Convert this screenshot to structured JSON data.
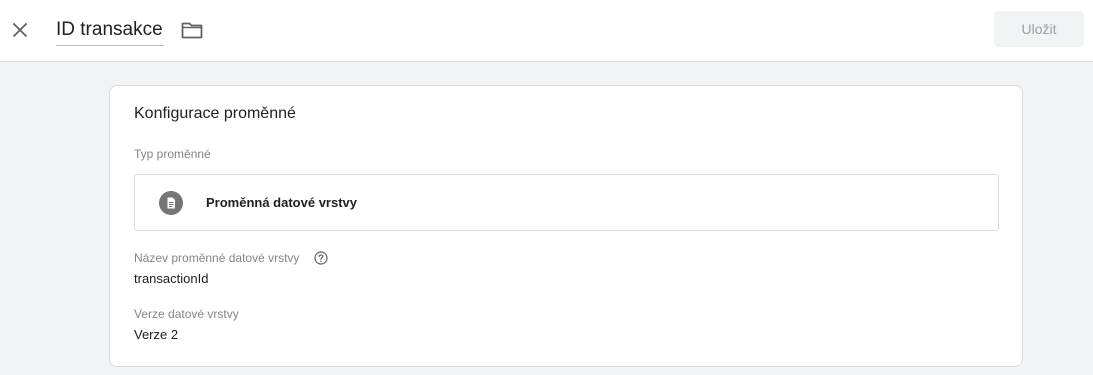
{
  "header": {
    "close_icon": "close-icon",
    "title": "ID transakce",
    "folder_icon": "folder-icon",
    "save_label": "Uložit"
  },
  "config": {
    "heading": "Konfigurace proměnné",
    "type_label": "Typ proměnné",
    "type_icon": "document-icon",
    "type_name": "Proměnná datové vrstvy",
    "dl_name_label": "Název proměnné datové vrstvy",
    "help_icon": "help-icon",
    "dl_name_value": "transactionId",
    "dl_version_label": "Verze datové vrstvy",
    "dl_version_value": "Verze 2"
  },
  "colors": {
    "accent_disabled": "#9aa0a6",
    "page_bg": "#f1f3f4",
    "icon_gray": "#757575"
  }
}
